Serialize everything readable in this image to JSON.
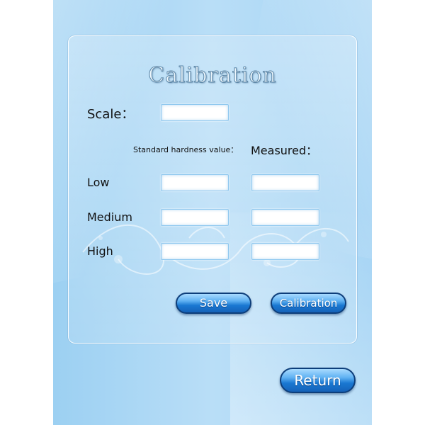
{
  "title": "Calibration",
  "scale": {
    "label": "Scale：",
    "value": ""
  },
  "columns": {
    "standard": "Standard hardness value：",
    "measured": "Measured："
  },
  "rows": [
    {
      "label": "Low",
      "standard": "",
      "measured": ""
    },
    {
      "label": "Medium",
      "standard": "",
      "measured": ""
    },
    {
      "label": "High",
      "standard": "",
      "measured": ""
    }
  ],
  "buttons": {
    "save": "Save",
    "calibration": "Calibration",
    "return": "Return"
  },
  "colors": {
    "background": "#b1daf6",
    "button": "#1a78d2",
    "button_border": "#0d3e7a",
    "field_border": "#8fc8ef"
  }
}
